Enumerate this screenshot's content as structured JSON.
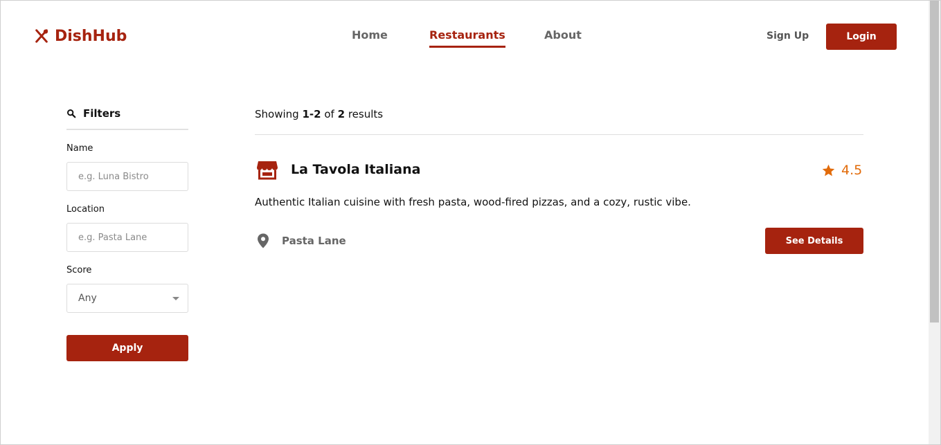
{
  "header": {
    "brand": "DishHub",
    "nav": [
      {
        "label": "Home",
        "active": false
      },
      {
        "label": "Restaurants",
        "active": true
      },
      {
        "label": "About",
        "active": false
      }
    ],
    "signup_label": "Sign Up",
    "login_label": "Login"
  },
  "filters": {
    "title": "Filters",
    "name_label": "Name",
    "name_placeholder": "e.g. Luna Bistro",
    "location_label": "Location",
    "location_placeholder": "e.g. Pasta Lane",
    "score_label": "Score",
    "score_value": "Any",
    "apply_label": "Apply"
  },
  "results": {
    "showing_prefix": "Showing",
    "range": "1-2",
    "of_text": "of",
    "total": "2",
    "suffix": "results",
    "items": [
      {
        "name": "La Tavola Italiana",
        "rating": "4.5",
        "description": "Authentic Italian cuisine with fresh pasta, wood-fired pizzas, and a cozy, rustic vibe.",
        "location": "Pasta Lane",
        "details_label": "See Details"
      }
    ]
  },
  "colors": {
    "brand": "#a6230f",
    "rating": "#e26b0a",
    "muted_text": "#666666"
  },
  "icons": {
    "logo": "utensils-crossed-icon",
    "filters": "search-icon",
    "restaurant": "storefront-icon",
    "rating": "star-icon",
    "location": "map-pin-icon",
    "select": "chevron-down-icon"
  }
}
